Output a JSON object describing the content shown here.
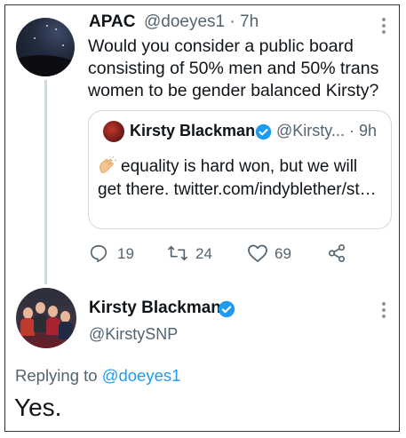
{
  "tweet": {
    "display_name": "APAC",
    "handle": "@doeyes1",
    "time": "· 7h",
    "text": "Would you consider a public board consisting of 50% men and 50% trans women to be gender balanced Kirsty?",
    "avatar_icon": "night-sky-avatar",
    "more_icon": "more-vertical-icon"
  },
  "quoted_tweet": {
    "display_name": "Kirsty Blackman",
    "handle": "@Kirsty...",
    "time": "· 9h",
    "emoji": "clapping-hands-icon",
    "text": "equality is hard won, but we will get there. twitter.com/indyblether/st…",
    "verified_color": "#1d9bf0"
  },
  "actions": {
    "replies": "19",
    "retweets": "24",
    "likes": "69"
  },
  "reply": {
    "display_name": "Kirsty Blackman",
    "handle": "@KirstySNP",
    "replying_label": "Replying to",
    "replying_to": "@doeyes1",
    "text": "Yes."
  },
  "colors": {
    "accent": "#1d9bf0",
    "muted": "#536471",
    "border": "#cfd9de"
  }
}
